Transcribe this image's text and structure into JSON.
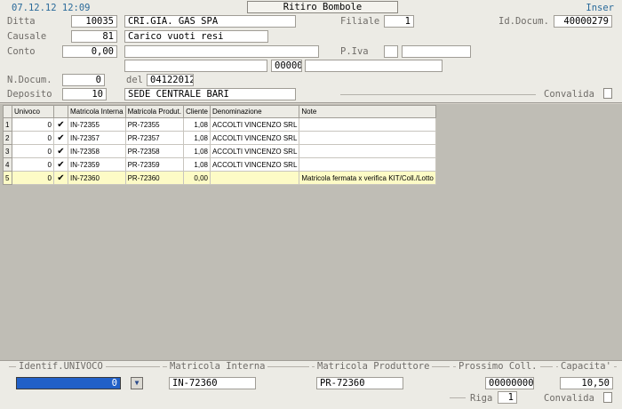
{
  "header": {
    "datetime": "07.12.12 12:09",
    "title": "Ritiro  Bombole",
    "mode": "Inser"
  },
  "form": {
    "ditta_label": "Ditta",
    "ditta_code": "10035",
    "ditta_name": "CRI.GIA. GAS SPA",
    "filiale_label": "Filiale",
    "filiale_value": "1",
    "iddocum_label": "Id.Docum.",
    "iddocum_value": "40000279",
    "causale_label": "Causale",
    "causale_code": "81",
    "causale_desc": "Carico vuoti resi",
    "conto_label": "Conto",
    "conto_value": "0,00",
    "conto_name": "",
    "piva_label": "P.Iva",
    "piva_a": "",
    "piva_b": "",
    "address": "",
    "cap": "00000",
    "city": "",
    "ndocum_label": "N.Docum.",
    "ndocum_value": "0",
    "del_label": "del",
    "del_value": "04122012",
    "deposito_label": "Deposito",
    "deposito_code": "10",
    "deposito_name": "SEDE CENTRALE BARI",
    "convalida_label": "Convalida"
  },
  "grid": {
    "columns": [
      "Univoco",
      "",
      "Matricola Interna",
      "Matricola Produt.",
      "Cliente",
      "Denominazione",
      "Note"
    ],
    "rows": [
      {
        "n": "1",
        "univoco": "0",
        "check": "✔",
        "interna": "IN-72355",
        "produt": "PR-72355",
        "cliente": "1,08",
        "denom": "ACCOLTI VINCENZO SRL",
        "note": ""
      },
      {
        "n": "2",
        "univoco": "0",
        "check": "✔",
        "interna": "IN-72357",
        "produt": "PR-72357",
        "cliente": "1,08",
        "denom": "ACCOLTI VINCENZO SRL",
        "note": ""
      },
      {
        "n": "3",
        "univoco": "0",
        "check": "✔",
        "interna": "IN-72358",
        "produt": "PR-72358",
        "cliente": "1,08",
        "denom": "ACCOLTI VINCENZO SRL",
        "note": ""
      },
      {
        "n": "4",
        "univoco": "0",
        "check": "✔",
        "interna": "IN-72359",
        "produt": "PR-72359",
        "cliente": "1,08",
        "denom": "ACCOLTI VINCENZO SRL",
        "note": ""
      },
      {
        "n": "5",
        "univoco": "0",
        "check": "✔",
        "interna": "IN-72360",
        "produt": "PR-72360",
        "cliente": "0,00",
        "denom": "",
        "note": "Matricola fermata x verifica KIT/Coll./Lotto"
      }
    ]
  },
  "footer": {
    "identif_label": "Identif.UNIVOCO",
    "identif_value": "0",
    "interna_label": "Matricola Interna",
    "interna_value": "IN-72360",
    "produttore_label": "Matricola Produttore",
    "produttore_value": "PR-72360",
    "prossimo_label": "Prossimo Coll.",
    "prossimo_value": "00000000",
    "capacita_label": "Capacita'",
    "capacita_value": "10,50",
    "riga_label": "Riga",
    "riga_value": "1",
    "convalida_label": "Convalida"
  }
}
